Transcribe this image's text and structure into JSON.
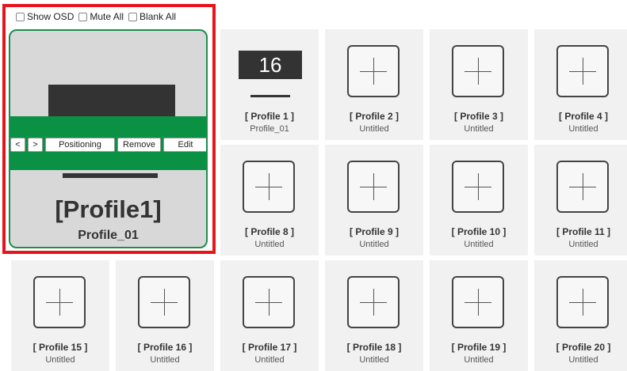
{
  "toolbar": {
    "show_osd": "Show OSD",
    "mute_all": "Mute All",
    "blank_all": "Blank All"
  },
  "selected": {
    "prev": "<",
    "next": ">",
    "positioning": "Positioning",
    "remove": "Remove",
    "edit": "Edit",
    "title": "[Profile1]",
    "subtitle": "Profile_01"
  },
  "tiles": [
    {
      "name": "[ Profile 1 ]",
      "sub": "Profile_01",
      "number": "16"
    },
    {
      "name": "[ Profile 2 ]",
      "sub": "Untitled"
    },
    {
      "name": "[ Profile 3 ]",
      "sub": "Untitled"
    },
    {
      "name": "[ Profile 4 ]",
      "sub": "Untitled"
    },
    {
      "name": "[ Profile 8 ]",
      "sub": "Untitled"
    },
    {
      "name": "[ Profile 9 ]",
      "sub": "Untitled"
    },
    {
      "name": "[ Profile 10 ]",
      "sub": "Untitled"
    },
    {
      "name": "[ Profile 11 ]",
      "sub": "Untitled"
    },
    {
      "name": "[ Profile 15 ]",
      "sub": "Untitled"
    },
    {
      "name": "[ Profile 16 ]",
      "sub": "Untitled"
    },
    {
      "name": "[ Profile 17 ]",
      "sub": "Untitled"
    },
    {
      "name": "[ Profile 18 ]",
      "sub": "Untitled"
    },
    {
      "name": "[ Profile 19 ]",
      "sub": "Untitled"
    },
    {
      "name": "[ Profile 20 ]",
      "sub": "Untitled"
    }
  ],
  "colors": {
    "highlight": "#e8141c",
    "accent_green": "#0a9144",
    "tile_bg": "#f1f1f1"
  }
}
